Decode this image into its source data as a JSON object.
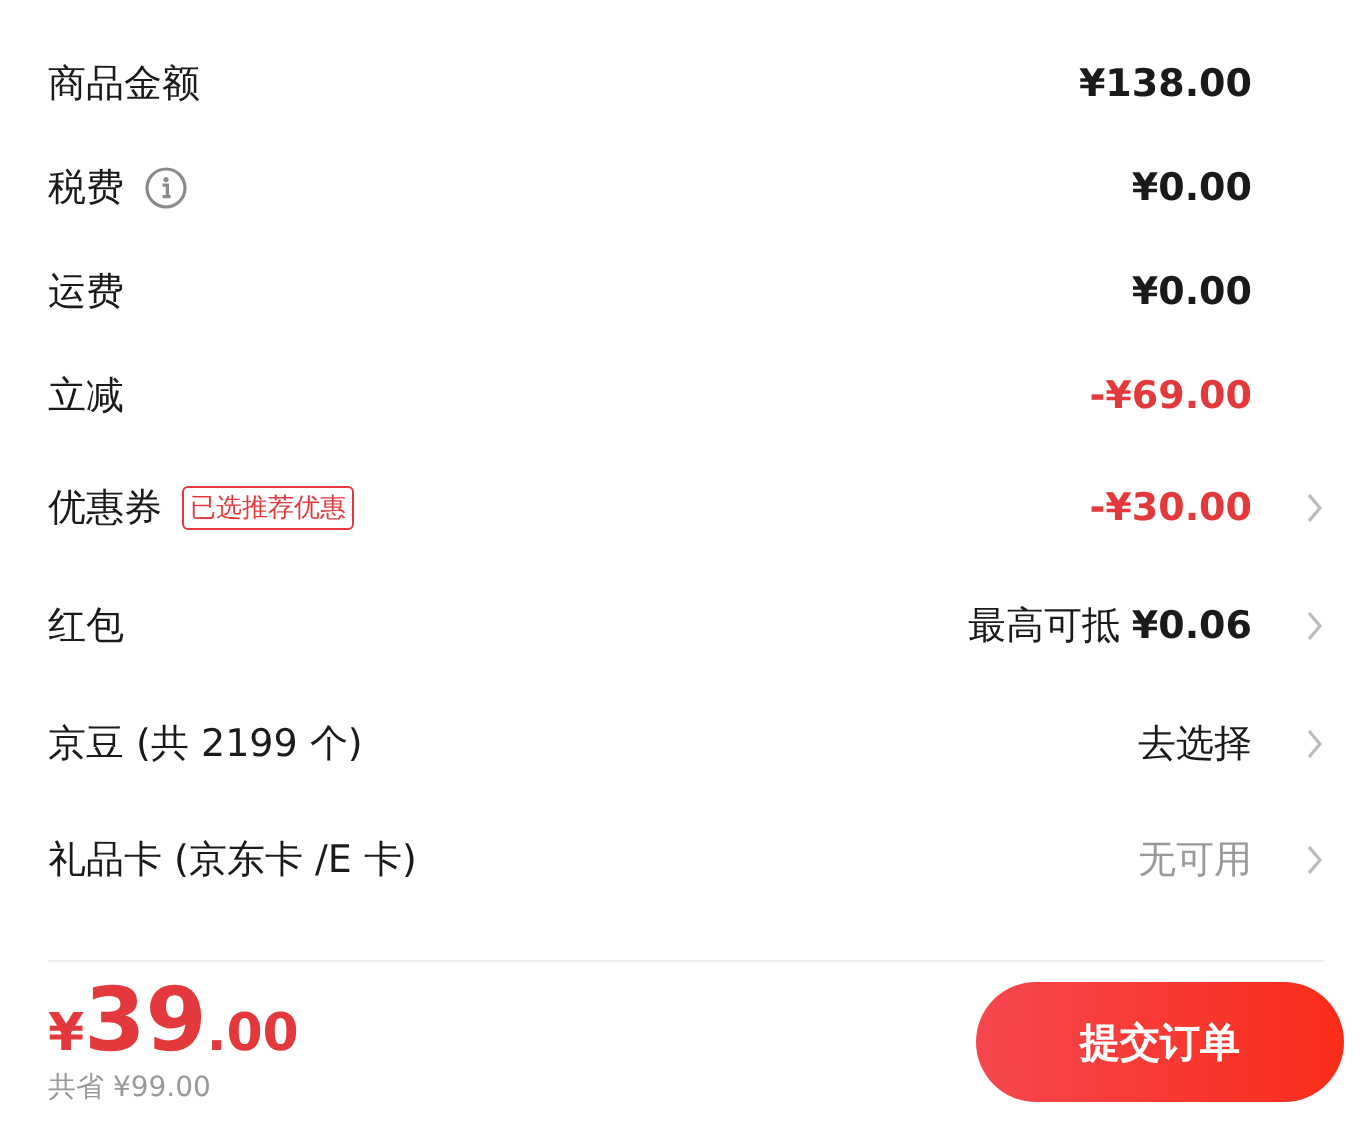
{
  "rows": [
    {
      "label": "商品金额",
      "info": false,
      "value": "¥138.00",
      "kind": "normal",
      "arrow": false
    },
    {
      "label": "税费",
      "info": true,
      "value": "¥0.00",
      "kind": "normal",
      "arrow": false
    },
    {
      "label": "运费",
      "info": false,
      "value": "¥0.00",
      "kind": "normal",
      "arrow": false
    },
    {
      "label": "立减",
      "info": false,
      "value": "-¥69.00",
      "kind": "discount",
      "arrow": false
    },
    {
      "label": "优惠券",
      "info": false,
      "tag": "已选推荐优惠",
      "value": "-¥30.00",
      "kind": "discount",
      "arrow": true
    },
    {
      "label": "红包",
      "info": false,
      "prefix": "最高可抵",
      "value": "¥0.06",
      "kind": "normal",
      "arrow": true
    },
    {
      "label": "京豆 (共 2199 个)",
      "info": false,
      "value": "去选择",
      "kind": "plain",
      "arrow": true
    },
    {
      "label": "礼品卡 (京东卡 /E 卡)",
      "info": false,
      "value": "无可用",
      "kind": "muted",
      "arrow": true
    }
  ],
  "footer": {
    "currency": "¥",
    "integer": "39",
    "decimals": ".00",
    "saved": "共省 ¥99.00",
    "submit": "提交订单"
  }
}
